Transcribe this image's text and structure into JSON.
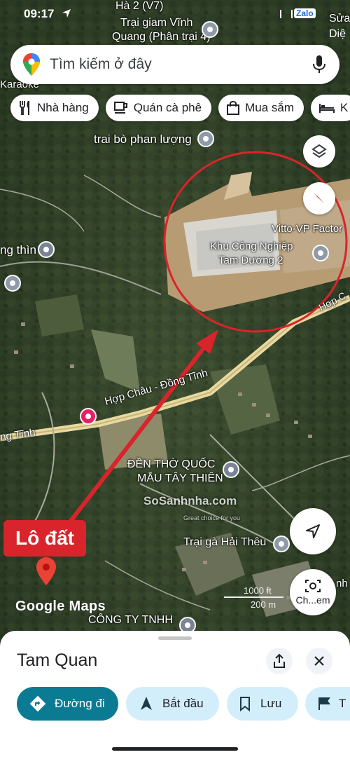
{
  "status_bar": {
    "time": "09:17",
    "icons": "Zalo",
    "right_text": "Diệ"
  },
  "search": {
    "placeholder": "Tìm kiếm ở đây"
  },
  "chips": [
    {
      "label": "Nhà hàng",
      "icon": "fork-knife-icon"
    },
    {
      "label": "Quán cà phê",
      "icon": "coffee-cup-icon"
    },
    {
      "label": "Mua sắm",
      "icon": "shopping-bag-icon"
    },
    {
      "label": "K",
      "icon": "bed-icon"
    }
  ],
  "map_labels": {
    "top1": "Hà 2 (V7)",
    "top2": "Trại giam Vĩnh",
    "top3": "Quang (Phân trại 4)",
    "top_right": "Sửa",
    "karaoke": "Karaoke",
    "trai_bo": "trai bò phan lượng",
    "vitto": "Vitto-VP Factor",
    "kcn1": "Khu Công Nghiệp",
    "kcn2": "Tam Dương 2",
    "hop_c": "Hợp C",
    "dong_thin": "ng thìn",
    "hop_chau": "Hợp Châu - Đồng Tĩnh",
    "ng_tinh": "ng Tĩnh",
    "den_tho1": "ĐỀN THỜ QUỐC",
    "den_tho2": "MẪU TÂY THIÊN",
    "trai_ga": "Trại gà Hải Thêu",
    "cong_ty": "CÔNG TY TNHH",
    "nh": "nh",
    "scale1": "1000 ft",
    "scale2": "200 m",
    "watermark": "SoSanhnha.com",
    "watermark_sub": "Great choice for you",
    "google_maps": "Google Maps",
    "lo_dat": "Lô đất",
    "explore": "Ch...em"
  },
  "sheet": {
    "title": "Tam Quan",
    "buttons": [
      {
        "label": "Đường đi",
        "icon": "directions-icon"
      },
      {
        "label": "Bắt đầu",
        "icon": "navigation-arrow-icon"
      },
      {
        "label": "Lưu",
        "icon": "bookmark-icon"
      },
      {
        "label": "T",
        "icon": "flag-icon"
      }
    ]
  },
  "colors": {
    "accent_teal": "#0b7a93",
    "chip_blue_bg": "#d3eefb",
    "annotation_red": "#d9242b",
    "road_yellow": "#e8d9a0"
  }
}
